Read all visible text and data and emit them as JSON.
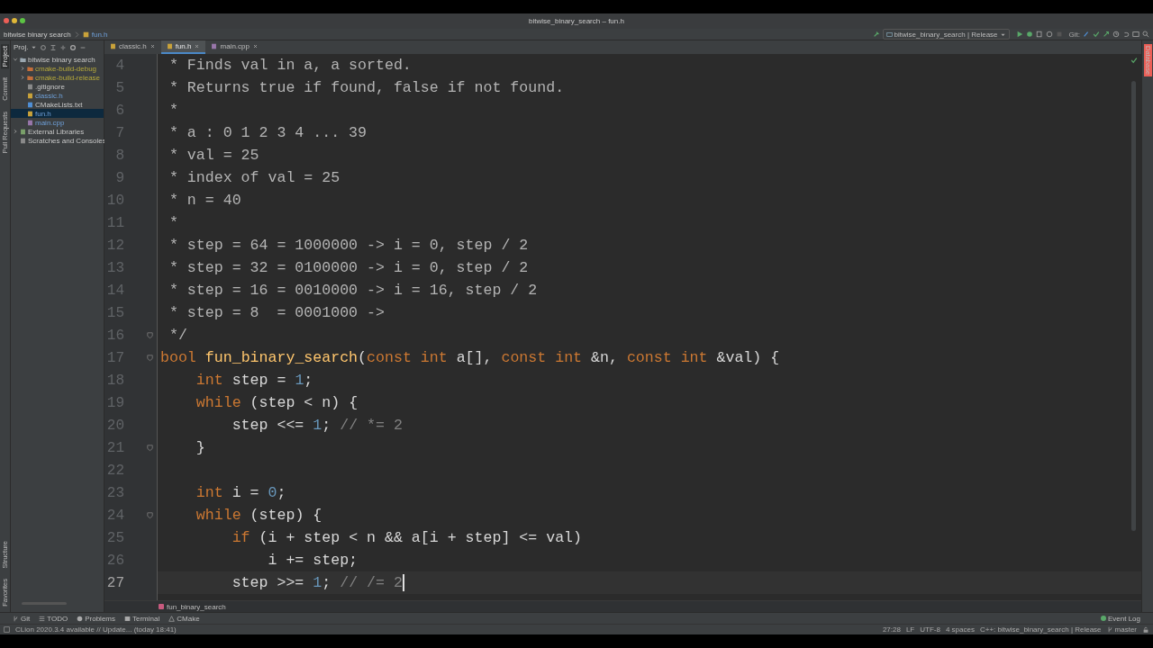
{
  "window": {
    "title": "bitwise_binary_search – fun.h"
  },
  "navbar": {
    "project": "bitwise binary search",
    "file": "fun.h"
  },
  "run_config": "bitwise_binary_search | Release",
  "git_label": "Git:",
  "left_strip": [
    {
      "label": "Project",
      "selected": true
    },
    {
      "label": "Commit",
      "selected": false
    },
    {
      "label": "Pull Requests",
      "selected": false
    }
  ],
  "left_strip_bottom": [
    {
      "label": "Structure"
    },
    {
      "label": "Favorites"
    }
  ],
  "right_strip": [
    {
      "label": "Database"
    }
  ],
  "project_panel": {
    "title": "Proj.",
    "tree": [
      {
        "label": "bitwise binary search",
        "kind": "folder",
        "expanded": true,
        "selected": false,
        "excluded": false,
        "modified": false,
        "children": [
          {
            "label": "cmake-build-debug",
            "kind": "folder-excluded",
            "expanded": false,
            "selected": false,
            "excluded": true,
            "modified": false
          },
          {
            "label": "cmake-build-release",
            "kind": "folder-excluded",
            "expanded": false,
            "selected": false,
            "excluded": true,
            "modified": false
          },
          {
            "label": ".gitignore",
            "kind": "file",
            "selected": false,
            "excluded": false,
            "modified": false
          },
          {
            "label": "classic.h",
            "kind": "header",
            "selected": false,
            "excluded": false,
            "modified": true
          },
          {
            "label": "CMakeLists.txt",
            "kind": "cmake",
            "selected": false,
            "excluded": false,
            "modified": false
          },
          {
            "label": "fun.h",
            "kind": "header",
            "selected": true,
            "excluded": false,
            "modified": true
          },
          {
            "label": "main.cpp",
            "kind": "cpp",
            "selected": false,
            "excluded": false,
            "modified": true
          }
        ]
      },
      {
        "label": "External Libraries",
        "kind": "library",
        "expanded": false,
        "selected": false,
        "excluded": false,
        "modified": false
      },
      {
        "label": "Scratches and Consoles",
        "kind": "scratch",
        "selected": false,
        "excluded": false,
        "modified": false
      }
    ]
  },
  "tabs": [
    {
      "label": "classic.h",
      "kind": "header",
      "selected": false
    },
    {
      "label": "fun.h",
      "kind": "header",
      "selected": true
    },
    {
      "label": "main.cpp",
      "kind": "cpp",
      "selected": false
    }
  ],
  "editor": {
    "lines": [
      {
        "n": "4",
        "fold": false,
        "current": false,
        "caret": false,
        "tokens": [
          {
            "kind": "doc",
            "text": " * Finds val in a, a sorted."
          }
        ]
      },
      {
        "n": "5",
        "fold": false,
        "current": false,
        "caret": false,
        "tokens": [
          {
            "kind": "doc",
            "text": " * Returns true if found, false if not found."
          }
        ]
      },
      {
        "n": "6",
        "fold": false,
        "current": false,
        "caret": false,
        "tokens": [
          {
            "kind": "doc",
            "text": " *"
          }
        ]
      },
      {
        "n": "7",
        "fold": false,
        "current": false,
        "caret": false,
        "tokens": [
          {
            "kind": "doc",
            "text": " * a : 0 1 2 3 4 ... 39"
          }
        ]
      },
      {
        "n": "8",
        "fold": false,
        "current": false,
        "caret": false,
        "tokens": [
          {
            "kind": "doc",
            "text": " * val = 25"
          }
        ]
      },
      {
        "n": "9",
        "fold": false,
        "current": false,
        "caret": false,
        "tokens": [
          {
            "kind": "doc",
            "text": " * index of val = 25"
          }
        ]
      },
      {
        "n": "10",
        "fold": false,
        "current": false,
        "caret": false,
        "tokens": [
          {
            "kind": "doc",
            "text": " * n = 40"
          }
        ]
      },
      {
        "n": "11",
        "fold": false,
        "current": false,
        "caret": false,
        "tokens": [
          {
            "kind": "doc",
            "text": " *"
          }
        ]
      },
      {
        "n": "12",
        "fold": false,
        "current": false,
        "caret": false,
        "tokens": [
          {
            "kind": "doc",
            "text": " * step = 64 = 1000000 -> i = 0, step / 2"
          }
        ]
      },
      {
        "n": "13",
        "fold": false,
        "current": false,
        "caret": false,
        "tokens": [
          {
            "kind": "doc",
            "text": " * step = 32 = 0100000 -> i = 0, step / 2"
          }
        ]
      },
      {
        "n": "14",
        "fold": false,
        "current": false,
        "caret": false,
        "tokens": [
          {
            "kind": "doc",
            "text": " * step = 16 = 0010000 -> i = 16, step / 2"
          }
        ]
      },
      {
        "n": "15",
        "fold": false,
        "current": false,
        "caret": false,
        "tokens": [
          {
            "kind": "doc",
            "text": " * step = 8  = 0001000 ->"
          }
        ]
      },
      {
        "n": "16",
        "fold": true,
        "current": false,
        "caret": false,
        "tokens": [
          {
            "kind": "doc",
            "text": " */"
          }
        ]
      },
      {
        "n": "17",
        "fold": true,
        "current": false,
        "caret": false,
        "tokens": [
          {
            "kind": "keyword",
            "text": "bool "
          },
          {
            "kind": "function",
            "text": "fun_binary_search"
          },
          {
            "kind": "plain",
            "text": "("
          },
          {
            "kind": "keyword",
            "text": "const int "
          },
          {
            "kind": "plain",
            "text": "a[], "
          },
          {
            "kind": "keyword",
            "text": "const int "
          },
          {
            "kind": "plain",
            "text": "&n, "
          },
          {
            "kind": "keyword",
            "text": "const int "
          },
          {
            "kind": "plain",
            "text": "&val) {"
          }
        ]
      },
      {
        "n": "18",
        "fold": false,
        "current": false,
        "caret": false,
        "tokens": [
          {
            "kind": "keyword",
            "text": "    int "
          },
          {
            "kind": "plain",
            "text": "step = "
          },
          {
            "kind": "number",
            "text": "1"
          },
          {
            "kind": "plain",
            "text": ";"
          }
        ]
      },
      {
        "n": "19",
        "fold": false,
        "current": false,
        "caret": false,
        "tokens": [
          {
            "kind": "keyword",
            "text": "    while "
          },
          {
            "kind": "plain",
            "text": "(step < n) {"
          }
        ]
      },
      {
        "n": "20",
        "fold": false,
        "current": false,
        "caret": false,
        "tokens": [
          {
            "kind": "plain",
            "text": "        step <<= "
          },
          {
            "kind": "number",
            "text": "1"
          },
          {
            "kind": "plain",
            "text": "; "
          },
          {
            "kind": "comment",
            "text": "// *= 2"
          }
        ]
      },
      {
        "n": "21",
        "fold": true,
        "current": false,
        "caret": false,
        "tokens": [
          {
            "kind": "plain",
            "text": "    }"
          }
        ]
      },
      {
        "n": "22",
        "fold": false,
        "current": false,
        "caret": false
      },
      {
        "n": "23",
        "fold": false,
        "current": false,
        "caret": false,
        "tokens": [
          {
            "kind": "keyword",
            "text": "    int "
          },
          {
            "kind": "plain",
            "text": "i = "
          },
          {
            "kind": "number",
            "text": "0"
          },
          {
            "kind": "plain",
            "text": ";"
          }
        ]
      },
      {
        "n": "24",
        "fold": true,
        "current": false,
        "caret": false,
        "tokens": [
          {
            "kind": "keyword",
            "text": "    while "
          },
          {
            "kind": "plain",
            "text": "(step) {"
          }
        ]
      },
      {
        "n": "25",
        "fold": false,
        "current": false,
        "caret": false,
        "tokens": [
          {
            "kind": "keyword",
            "text": "        if "
          },
          {
            "kind": "plain",
            "text": "(i + step < n && a[i + step] <= val)"
          }
        ]
      },
      {
        "n": "26",
        "fold": false,
        "current": false,
        "caret": false,
        "tokens": [
          {
            "kind": "plain",
            "text": "            i += step;"
          }
        ]
      },
      {
        "n": "27",
        "fold": false,
        "current": true,
        "caret": true,
        "tokens": [
          {
            "kind": "plain",
            "text": "        step >>= "
          },
          {
            "kind": "number",
            "text": "1"
          },
          {
            "kind": "plain",
            "text": "; "
          },
          {
            "kind": "comment",
            "text": "// /= 2"
          }
        ]
      }
    ]
  },
  "breadcrumb": "fun_binary_search",
  "tool_windows": [
    {
      "label": "Git",
      "kind": "git"
    },
    {
      "label": "TODO",
      "kind": "todo"
    },
    {
      "label": "Problems",
      "kind": "problems"
    },
    {
      "label": "Terminal",
      "kind": "terminal"
    },
    {
      "label": "CMake",
      "kind": "cmake"
    }
  ],
  "event_log": "Event Log",
  "status": {
    "message": "CLion 2020.3.4 available // Update... (today 18:41)",
    "items": [
      "27:28",
      "LF",
      "UTF-8",
      "4 spaces",
      "C++: bitwise_binary_search | Release"
    ],
    "branch": "master"
  }
}
